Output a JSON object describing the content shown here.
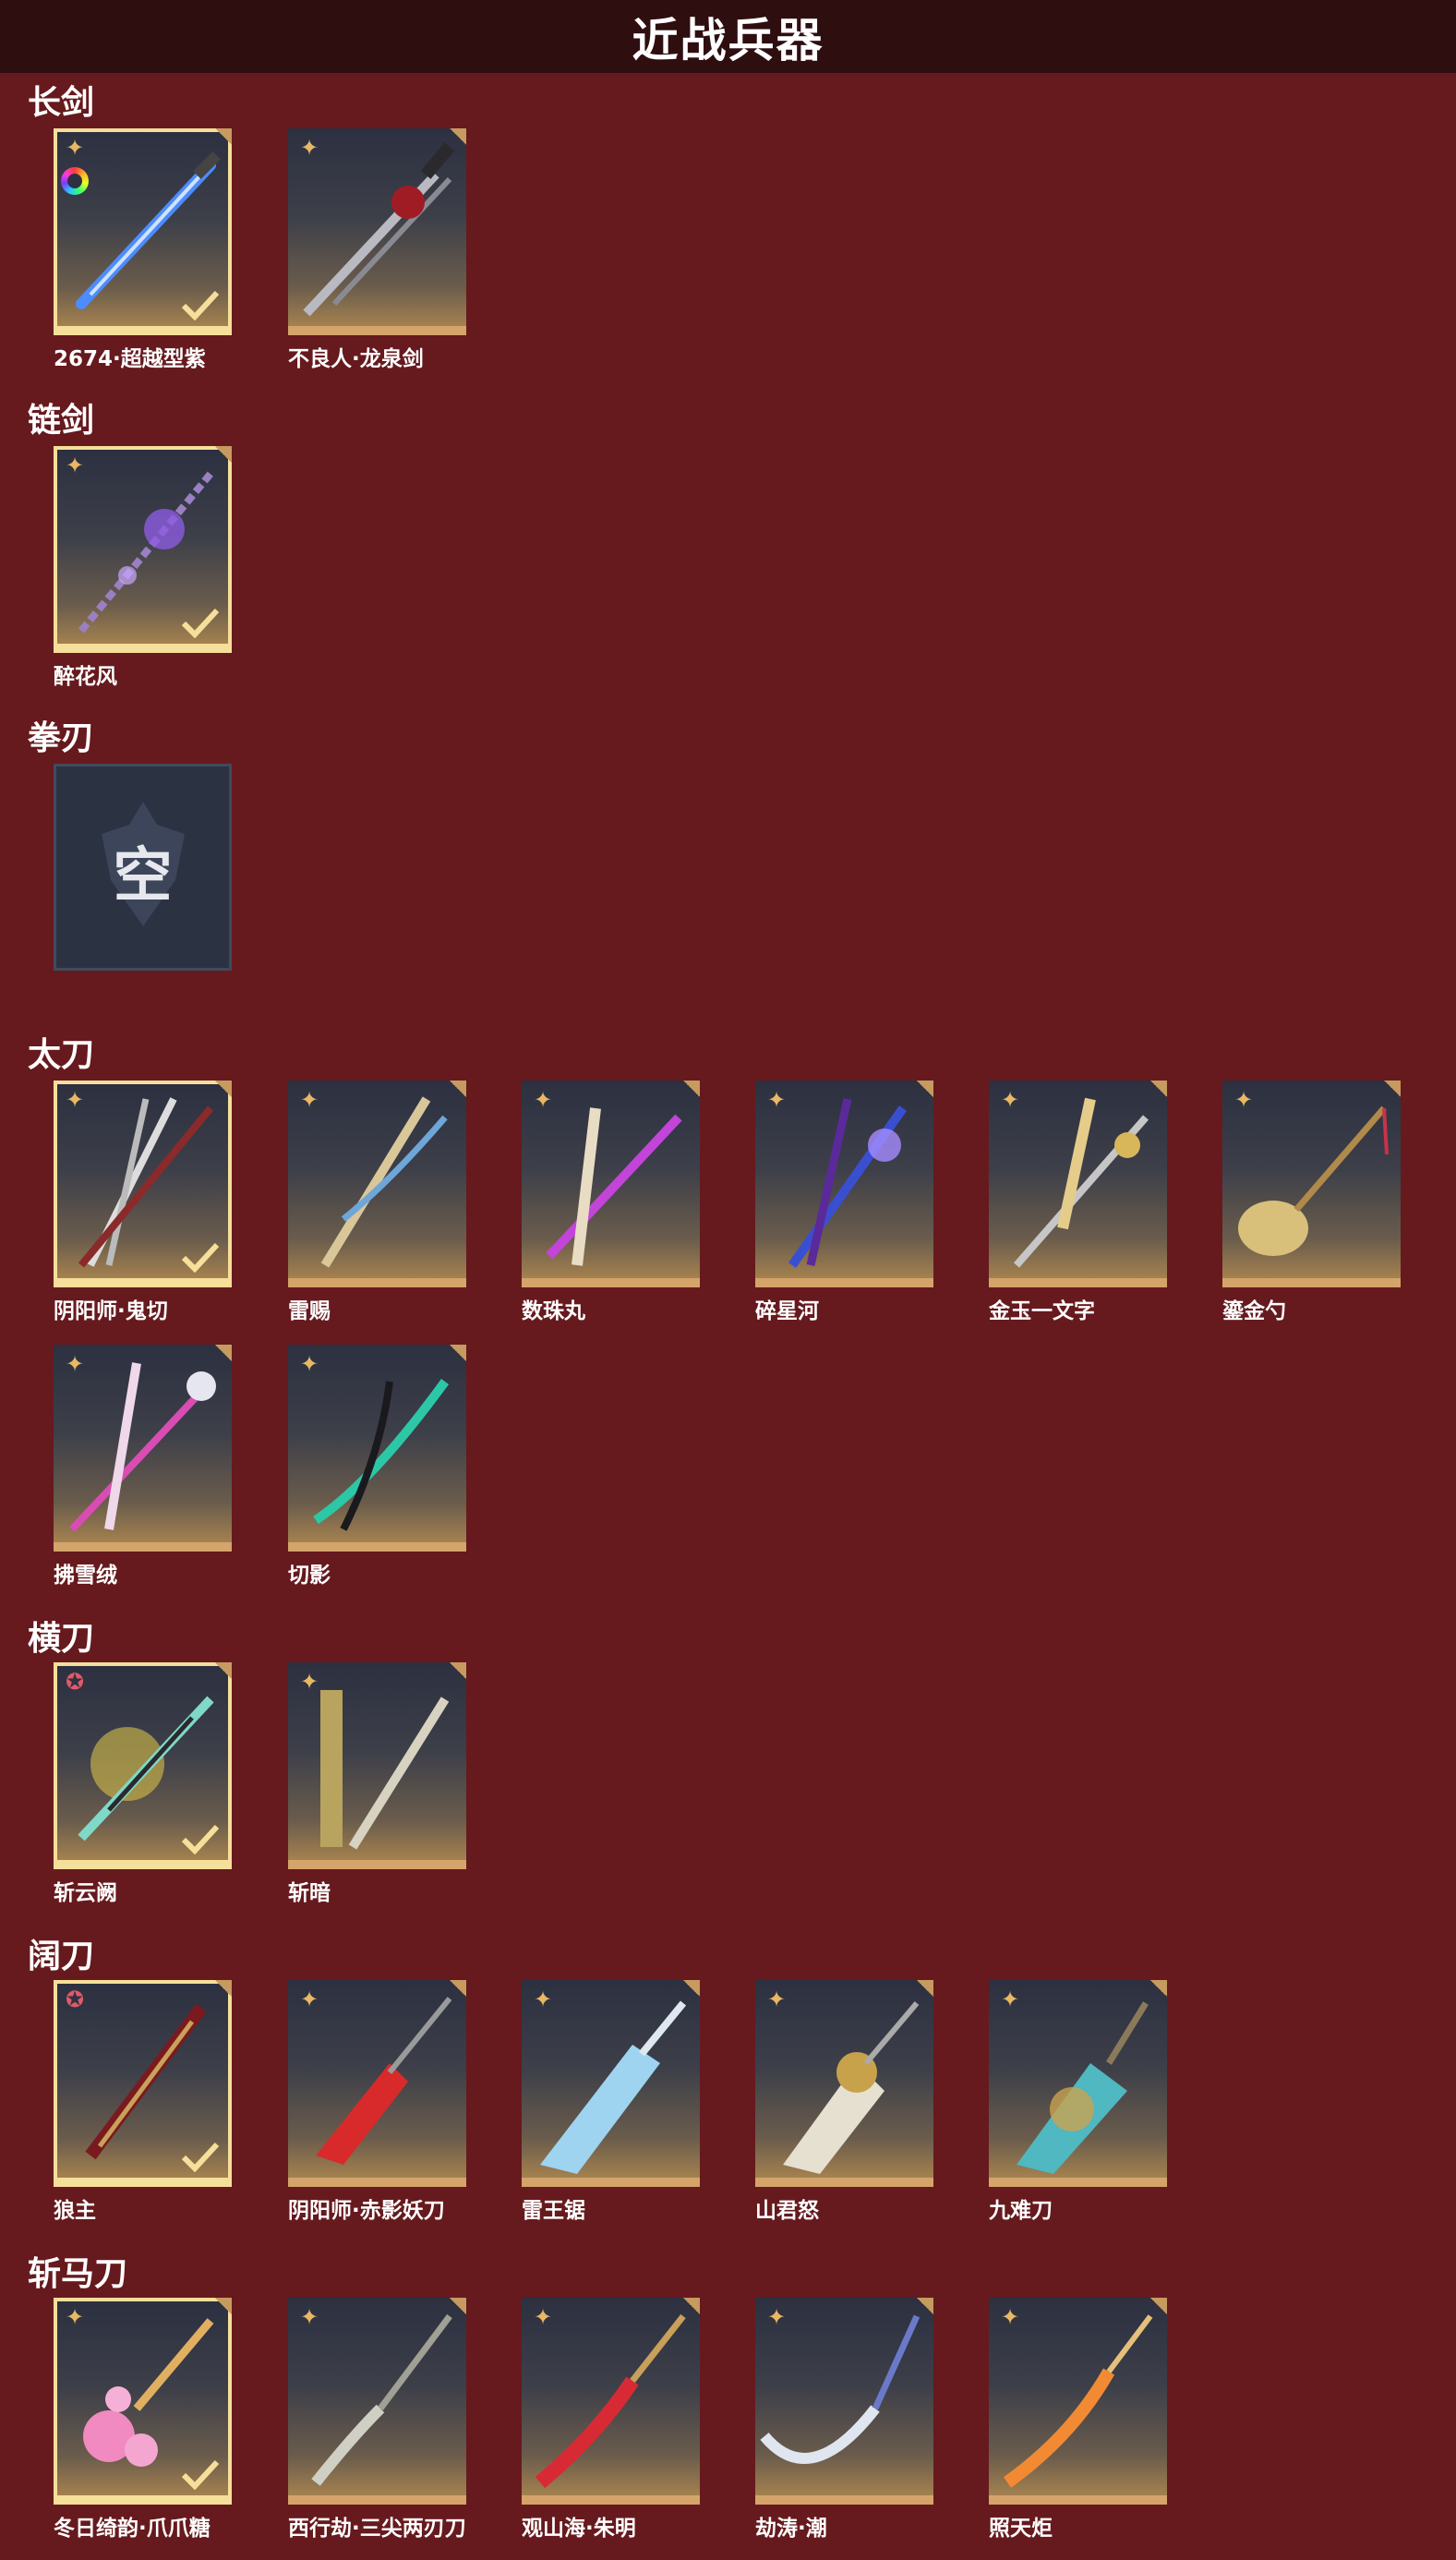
{
  "page_title": "近战兵器",
  "colors": {
    "background": "#661a1e",
    "header": "#2f0e10",
    "card_border_gold": "#d4a46a",
    "selected_border": "#f6df9a"
  },
  "sections": {
    "longsword": {
      "title": "长剑",
      "items": [
        {
          "name": "2674·超越型紫",
          "icon": "gold-star-icon",
          "selected": true,
          "has_color_ring": true
        },
        {
          "name": "不良人·龙泉剑",
          "icon": "gold-star-icon",
          "selected": false
        }
      ]
    },
    "chainsword": {
      "title": "链剑",
      "items": [
        {
          "name": "醉花风",
          "icon": "gold-star-icon",
          "selected": true
        }
      ]
    },
    "fistblade": {
      "title": "拳刃",
      "items": [
        {
          "name": "",
          "empty_label": "空",
          "empty": true
        }
      ]
    },
    "katana": {
      "title": "太刀",
      "items": [
        {
          "name": "阴阳师·鬼切",
          "icon": "gold-star-icon",
          "selected": true
        },
        {
          "name": "雷赐",
          "icon": "gold-star-icon",
          "selected": false
        },
        {
          "name": "数珠丸",
          "icon": "gold-star-icon",
          "selected": false
        },
        {
          "name": "碎星河",
          "icon": "gold-star-icon",
          "selected": false
        },
        {
          "name": "金玉一文字",
          "icon": "gold-star-icon",
          "selected": false
        },
        {
          "name": "鎏金勺",
          "icon": "gold-star-icon",
          "selected": false
        },
        {
          "name": "拂雪绒",
          "icon": "gold-star-icon",
          "selected": false
        },
        {
          "name": "切影",
          "icon": "gold-star-icon",
          "selected": false
        }
      ]
    },
    "hengdao": {
      "title": "横刀",
      "items": [
        {
          "name": "斩云阙",
          "icon": "red-star-icon",
          "selected": true
        },
        {
          "name": "斩暗",
          "icon": "gold-star-icon",
          "selected": false
        }
      ]
    },
    "kuodao": {
      "title": "阔刀",
      "items": [
        {
          "name": "狼主",
          "icon": "red-star-icon",
          "selected": true
        },
        {
          "name": "阴阳师·赤影妖刀",
          "icon": "gold-star-icon",
          "selected": false
        },
        {
          "name": "雷王锯",
          "icon": "gold-star-icon",
          "selected": false
        },
        {
          "name": "山君怒",
          "icon": "gold-star-icon",
          "selected": false
        },
        {
          "name": "九难刀",
          "icon": "gold-star-icon",
          "selected": false
        }
      ]
    },
    "zhanmadao": {
      "title": "斩马刀",
      "items": [
        {
          "name": "冬日绮韵·爪爪糖",
          "icon": "gold-star-icon",
          "selected": true
        },
        {
          "name": "西行劫·三尖两刃刀",
          "icon": "gold-star-icon",
          "selected": false
        },
        {
          "name": "观山海·朱明",
          "icon": "gold-star-icon",
          "selected": false
        },
        {
          "name": "劫涛·潮",
          "icon": "gold-star-icon",
          "selected": false
        },
        {
          "name": "照天炬",
          "icon": "gold-star-icon",
          "selected": false
        }
      ]
    }
  }
}
